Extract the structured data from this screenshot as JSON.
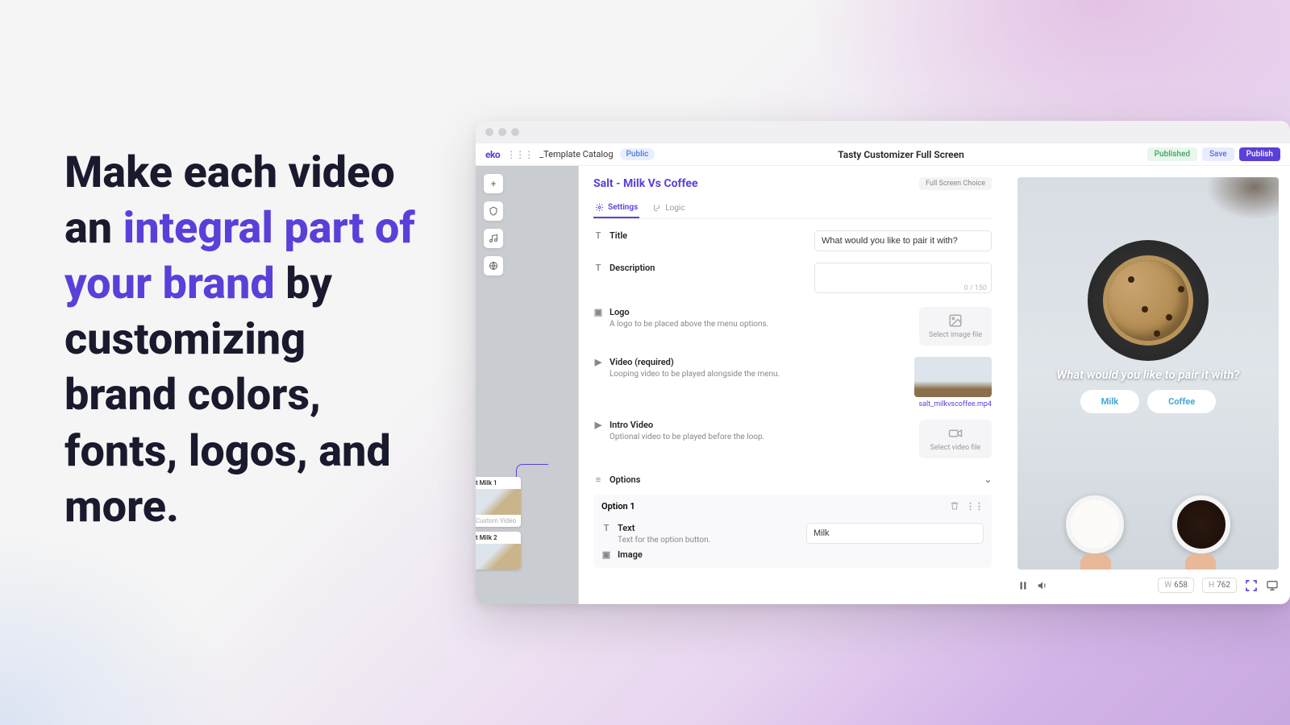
{
  "marketing": {
    "line1": "Make each video an ",
    "accent": "integral part of your brand",
    "line2": " by customizing brand colors, fonts, logos, and more."
  },
  "topbar": {
    "brand": "eko",
    "breadcrumb": "_Template Catalog",
    "visibility": "Public",
    "title": "Tasty Customizer Full Screen",
    "status": "Published",
    "save": "Save",
    "publish": "Publish"
  },
  "rail": {
    "node1": "t Milk 1",
    "node2": "t Milk 2",
    "node_hint": "Custom Video"
  },
  "panel": {
    "title": "Salt - Milk Vs Coffee",
    "type_chip": "Full Screen Choice",
    "tabs": {
      "settings": "Settings",
      "logic": "Logic"
    },
    "fields": {
      "title_label": "Title",
      "title_value": "What would you like to pair it with?",
      "desc_label": "Description",
      "desc_counter": "0 / 150",
      "logo_label": "Logo",
      "logo_sub": "A logo to be placed above the menu options.",
      "logo_upload": "Select image file",
      "video_label": "Video (required)",
      "video_sub": "Looping video to be played alongside the menu.",
      "video_file": "salt_milkvscoffee.mp4",
      "intro_label": "Intro Video",
      "intro_sub": "Optional video to be played before the loop.",
      "intro_upload": "Select video file"
    },
    "options": {
      "header": "Options",
      "opt1": "Option 1",
      "text_label": "Text",
      "text_sub": "Text for the option button.",
      "text_value": "Milk",
      "image_label": "Image"
    }
  },
  "preview": {
    "question": "What would you like to pair it with?",
    "btn1": "Milk",
    "btn2": "Coffee",
    "w_label": "W",
    "w_val": "658",
    "h_label": "H",
    "h_val": "762"
  }
}
